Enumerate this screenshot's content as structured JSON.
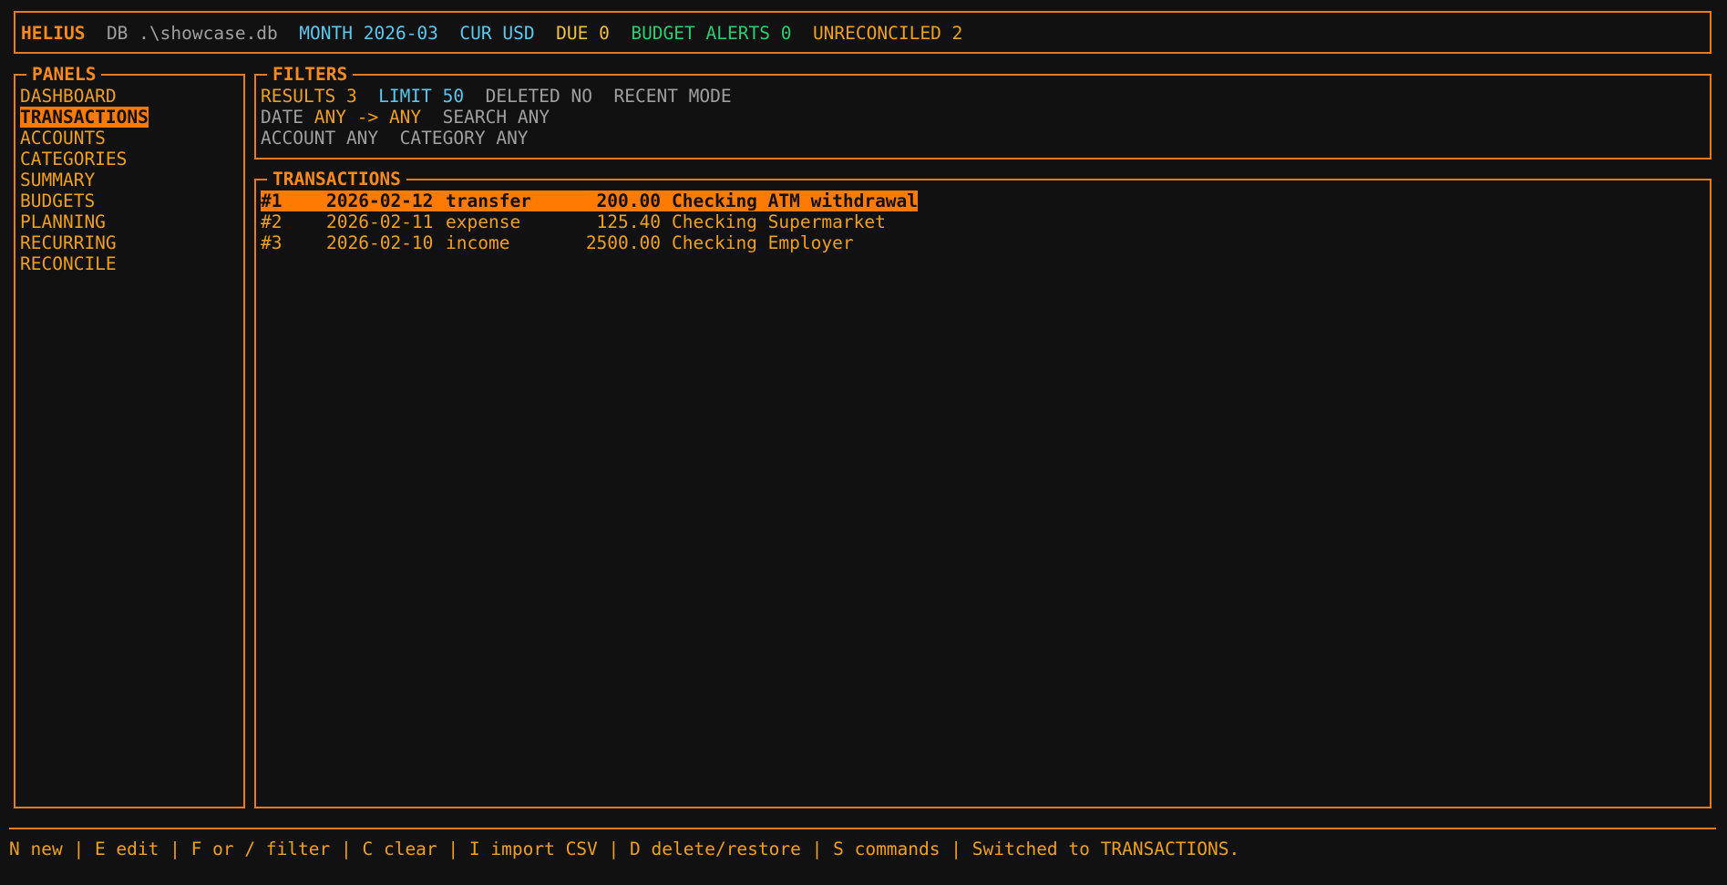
{
  "header": {
    "app": "HELIUS",
    "db_label": "DB",
    "db_path": ".\\showcase.db",
    "month_label": "MONTH",
    "month_value": "2026-03",
    "cur_label": "CUR",
    "cur_value": "USD",
    "due_label": "DUE",
    "due_value": "0",
    "budget_label": "BUDGET ALERTS",
    "budget_value": "0",
    "unrec_label": "UNRECONCILED",
    "unrec_value": "2"
  },
  "sidebar": {
    "title": "PANELS",
    "items": [
      {
        "label": "DASHBOARD"
      },
      {
        "label": "TRANSACTIONS",
        "selected": true
      },
      {
        "label": "ACCOUNTS"
      },
      {
        "label": "CATEGORIES"
      },
      {
        "label": "SUMMARY"
      },
      {
        "label": "BUDGETS"
      },
      {
        "label": "PLANNING"
      },
      {
        "label": "RECURRING"
      },
      {
        "label": "RECONCILE"
      }
    ]
  },
  "filters": {
    "title": "FILTERS",
    "results_label": "RESULTS",
    "results_value": "3",
    "limit_label": "LIMIT",
    "limit_value": "50",
    "deleted_label": "DELETED",
    "deleted_value": "NO",
    "mode_label": "RECENT MODE",
    "date_label": "DATE",
    "date_from": "ANY",
    "date_arrow": "->",
    "date_to": "ANY",
    "search_label": "SEARCH",
    "search_value": "ANY",
    "account_label": "ACCOUNT",
    "account_value": "ANY",
    "category_label": "CATEGORY",
    "category_value": "ANY"
  },
  "transactions": {
    "title": "TRANSACTIONS",
    "rows": [
      {
        "id": "#1",
        "date": "2026-02-12",
        "type": "transfer",
        "amount": "200.00",
        "account": "Checking",
        "memo": "ATM withdrawal",
        "selected": true
      },
      {
        "id": "#2",
        "date": "2026-02-11",
        "type": "expense",
        "amount": "125.40",
        "account": "Checking",
        "memo": "Supermarket"
      },
      {
        "id": "#3",
        "date": "2026-02-10",
        "type": "income",
        "amount": "2500.00",
        "account": "Checking",
        "memo": "Employer"
      }
    ]
  },
  "statusbar": {
    "new": "N new",
    "edit": "E edit",
    "filter": "F or / filter",
    "clear": "C clear",
    "import": "I import CSV",
    "delete": "D delete/restore",
    "commands": "S commands",
    "message": "Switched to TRANSACTIONS.",
    "separator": " | "
  },
  "colors": {
    "accent": "#ff7a00",
    "border": "#e87a1a",
    "text": "#f0a020",
    "blue": "#5bc8f0",
    "green": "#2ecc71",
    "gray": "#a0a0a0",
    "background": "#111111"
  }
}
